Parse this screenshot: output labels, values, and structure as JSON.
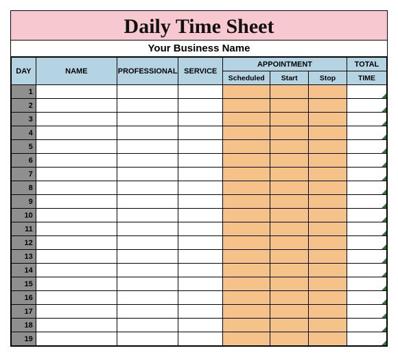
{
  "title": "Daily Time Sheet",
  "subtitle": "Your Business Name",
  "headers": {
    "day": "DAY",
    "name": "NAME",
    "professional": "PROFESSIONAL",
    "service": "SERVICE",
    "appointment": "APPOINTMENT",
    "scheduled": "Scheduled",
    "start": "Start",
    "stop": "Stop",
    "total": "TOTAL",
    "time": "TIME"
  },
  "rows": [
    {
      "day": "1",
      "name": "",
      "professional": "",
      "service": "",
      "scheduled": "",
      "start": "",
      "stop": "",
      "total": ""
    },
    {
      "day": "2",
      "name": "",
      "professional": "",
      "service": "",
      "scheduled": "",
      "start": "",
      "stop": "",
      "total": ""
    },
    {
      "day": "3",
      "name": "",
      "professional": "",
      "service": "",
      "scheduled": "",
      "start": "",
      "stop": "",
      "total": ""
    },
    {
      "day": "4",
      "name": "",
      "professional": "",
      "service": "",
      "scheduled": "",
      "start": "",
      "stop": "",
      "total": ""
    },
    {
      "day": "5",
      "name": "",
      "professional": "",
      "service": "",
      "scheduled": "",
      "start": "",
      "stop": "",
      "total": ""
    },
    {
      "day": "6",
      "name": "",
      "professional": "",
      "service": "",
      "scheduled": "",
      "start": "",
      "stop": "",
      "total": ""
    },
    {
      "day": "7",
      "name": "",
      "professional": "",
      "service": "",
      "scheduled": "",
      "start": "",
      "stop": "",
      "total": ""
    },
    {
      "day": "8",
      "name": "",
      "professional": "",
      "service": "",
      "scheduled": "",
      "start": "",
      "stop": "",
      "total": ""
    },
    {
      "day": "9",
      "name": "",
      "professional": "",
      "service": "",
      "scheduled": "",
      "start": "",
      "stop": "",
      "total": ""
    },
    {
      "day": "10",
      "name": "",
      "professional": "",
      "service": "",
      "scheduled": "",
      "start": "",
      "stop": "",
      "total": ""
    },
    {
      "day": "11",
      "name": "",
      "professional": "",
      "service": "",
      "scheduled": "",
      "start": "",
      "stop": "",
      "total": ""
    },
    {
      "day": "12",
      "name": "",
      "professional": "",
      "service": "",
      "scheduled": "",
      "start": "",
      "stop": "",
      "total": ""
    },
    {
      "day": "13",
      "name": "",
      "professional": "",
      "service": "",
      "scheduled": "",
      "start": "",
      "stop": "",
      "total": ""
    },
    {
      "day": "14",
      "name": "",
      "professional": "",
      "service": "",
      "scheduled": "",
      "start": "",
      "stop": "",
      "total": ""
    },
    {
      "day": "15",
      "name": "",
      "professional": "",
      "service": "",
      "scheduled": "",
      "start": "",
      "stop": "",
      "total": ""
    },
    {
      "day": "16",
      "name": "",
      "professional": "",
      "service": "",
      "scheduled": "",
      "start": "",
      "stop": "",
      "total": ""
    },
    {
      "day": "17",
      "name": "",
      "professional": "",
      "service": "",
      "scheduled": "",
      "start": "",
      "stop": "",
      "total": ""
    },
    {
      "day": "18",
      "name": "",
      "professional": "",
      "service": "",
      "scheduled": "",
      "start": "",
      "stop": "",
      "total": ""
    },
    {
      "day": "19",
      "name": "",
      "professional": "",
      "service": "",
      "scheduled": "",
      "start": "",
      "stop": "",
      "total": ""
    }
  ]
}
